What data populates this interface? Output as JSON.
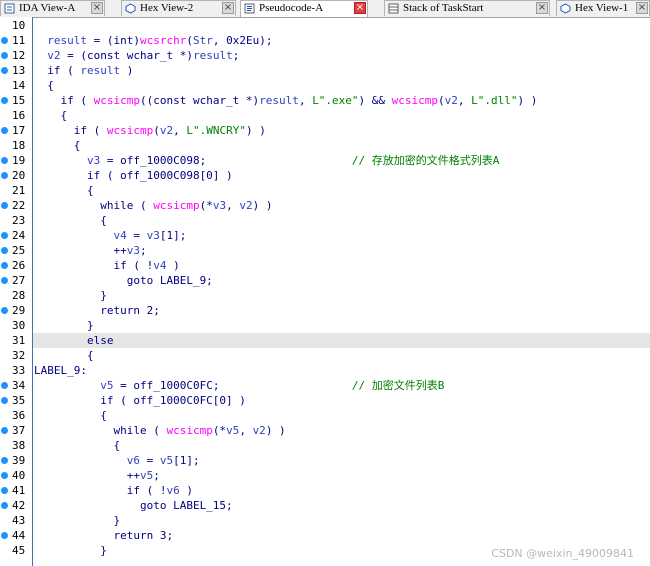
{
  "tabs": [
    {
      "label": "IDA View-A",
      "icon": "ida-view-icon",
      "active": false
    },
    {
      "label": "Hex View-2",
      "icon": "hex-view-icon",
      "active": false
    },
    {
      "label": "Pseudocode-A",
      "icon": "pseudocode-icon",
      "active": true
    },
    {
      "label": "Stack of TaskStart",
      "icon": "stack-icon",
      "active": false
    },
    {
      "label": "Hex View-1",
      "icon": "hex-view-icon",
      "active": false
    }
  ],
  "close_glyph": "×",
  "watermark": "CSDN @weixin_49009841",
  "highlight_line": 31,
  "lines": [
    {
      "n": "10",
      "dot": false,
      "code": ""
    },
    {
      "n": "11",
      "dot": true,
      "code": "  result = (int)wcsrchr(Str, 0x2Eu);"
    },
    {
      "n": "12",
      "dot": true,
      "code": "  v2 = (const wchar_t *)result;"
    },
    {
      "n": "13",
      "dot": true,
      "code": "  if ( result )"
    },
    {
      "n": "14",
      "dot": false,
      "code": "  {"
    },
    {
      "n": "15",
      "dot": true,
      "code": "    if ( wcsicmp((const wchar_t *)result, L\".exe\") && wcsicmp(v2, L\".dll\") )"
    },
    {
      "n": "16",
      "dot": false,
      "code": "    {"
    },
    {
      "n": "17",
      "dot": true,
      "code": "      if ( wcsicmp(v2, L\".WNCRY\") )"
    },
    {
      "n": "18",
      "dot": false,
      "code": "      {"
    },
    {
      "n": "19",
      "dot": true,
      "code": "        v3 = off_1000C098;                      // 存放加密的文件格式列表A"
    },
    {
      "n": "20",
      "dot": true,
      "code": "        if ( off_1000C098[0] )"
    },
    {
      "n": "21",
      "dot": false,
      "code": "        {"
    },
    {
      "n": "22",
      "dot": true,
      "code": "          while ( wcsicmp(*v3, v2) )"
    },
    {
      "n": "23",
      "dot": false,
      "code": "          {"
    },
    {
      "n": "24",
      "dot": true,
      "code": "            v4 = v3[1];"
    },
    {
      "n": "25",
      "dot": true,
      "code": "            ++v3;"
    },
    {
      "n": "26",
      "dot": true,
      "code": "            if ( !v4 )"
    },
    {
      "n": "27",
      "dot": true,
      "code": "              goto LABEL_9;"
    },
    {
      "n": "28",
      "dot": false,
      "code": "          }"
    },
    {
      "n": "29",
      "dot": true,
      "code": "          return 2;"
    },
    {
      "n": "30",
      "dot": false,
      "code": "        }"
    },
    {
      "n": "31",
      "dot": false,
      "code": "        else"
    },
    {
      "n": "32",
      "dot": false,
      "code": "        {"
    },
    {
      "n": "33",
      "dot": false,
      "code": "LABEL_9:"
    },
    {
      "n": "34",
      "dot": true,
      "code": "          v5 = off_1000C0FC;                    // 加密文件列表B"
    },
    {
      "n": "35",
      "dot": true,
      "code": "          if ( off_1000C0FC[0] )"
    },
    {
      "n": "36",
      "dot": false,
      "code": "          {"
    },
    {
      "n": "37",
      "dot": true,
      "code": "            while ( wcsicmp(*v5, v2) )"
    },
    {
      "n": "38",
      "dot": false,
      "code": "            {"
    },
    {
      "n": "39",
      "dot": true,
      "code": "              v6 = v5[1];"
    },
    {
      "n": "40",
      "dot": true,
      "code": "              ++v5;"
    },
    {
      "n": "41",
      "dot": true,
      "code": "              if ( !v6 )"
    },
    {
      "n": "42",
      "dot": true,
      "code": "                goto LABEL_15;"
    },
    {
      "n": "43",
      "dot": false,
      "code": "            }"
    },
    {
      "n": "44",
      "dot": true,
      "code": "            return 3;"
    },
    {
      "n": "45",
      "dot": false,
      "code": "          }"
    }
  ]
}
